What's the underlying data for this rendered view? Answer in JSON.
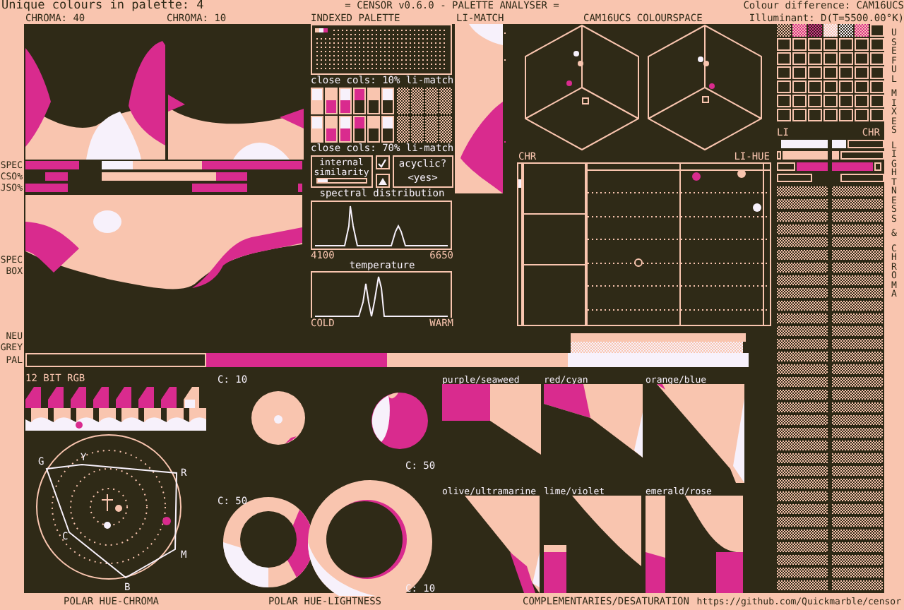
{
  "header": {
    "palette_count": "Unique colours in palette: 4",
    "title": "= CENSOR v0.6.0 - PALETTE ANALYSER =",
    "colour_difference": "Colour difference: CAM16UCS",
    "illuminant": "Illuminant: D(T=5500.00°K)"
  },
  "palette": [
    {
      "color": "#2f2a17"
    },
    {
      "color": "#d92b8e"
    },
    {
      "color": "#f9c5af"
    },
    {
      "color": "#f7f1fb"
    }
  ],
  "side_labels": {
    "spec": "SPEC",
    "cso": "CSO%",
    "jso": "JSO%",
    "spec_box": "SPEC BOX",
    "neutral_grey": "NEU GREY",
    "pal": "PAL"
  },
  "chroma_plots": [
    {
      "label": "CHROMA: 40"
    },
    {
      "label": "CHROMA: 10"
    }
  ],
  "indexed_palette": {
    "title": "INDEXED PALETTE"
  },
  "close_cols": [
    {
      "label": "close cols: 10% li-match"
    },
    {
      "label": "close cols: 70% li-match"
    }
  ],
  "internal_similarity": {
    "label": "internal similarity",
    "level": 0.2
  },
  "check_toggle": {
    "checked": true
  },
  "acyclic": {
    "label": "acyclic?",
    "value": "<yes>"
  },
  "spectral_distribution": {
    "title": "spectral distribution",
    "min_label": "4100",
    "max_label": "6650"
  },
  "temperature": {
    "title": "temperature",
    "min_label": "COLD",
    "max_label": "WARM"
  },
  "li_match": {
    "title": "LI-MATCH"
  },
  "colourspace": {
    "title": "CAM16UCS COLOURSPACE"
  },
  "hue_chart": {
    "chroma_label": "CHR",
    "lightness_hue_label": "LI-HUE"
  },
  "mixes": {
    "lightness_label": "LI",
    "chroma_label": "CHR",
    "side_title": [
      "USEFUL",
      "MIXES",
      "LIGHTNESS",
      "&",
      "CHROMA"
    ]
  },
  "rgb_12bit": {
    "title": "12 BIT RGB"
  },
  "polar_hue_chroma": {
    "title": "POLAR HUE-CHROMA",
    "hue_labels": [
      "G",
      "Y",
      "R",
      "C",
      "M",
      "B"
    ]
  },
  "polar_hue_lightness": {
    "title": "POLAR HUE-LIGHTNESS",
    "discs": [
      {
        "label": "C: 10"
      },
      {
        "label": "C: 50"
      },
      {
        "label": "C: 50"
      },
      {
        "label": "C: 10"
      }
    ]
  },
  "complementaries": {
    "title": "COMPLEMENTARIES/DESATURATION",
    "pairs": [
      {
        "label": "purple/seaweed"
      },
      {
        "label": "red/cyan"
      },
      {
        "label": "orange/blue"
      },
      {
        "label": "olive/ultramarine"
      },
      {
        "label": "lime/violet"
      },
      {
        "label": "emerald/rose"
      }
    ]
  },
  "footer_link": "https://github.com/Quickmarble/censor"
}
